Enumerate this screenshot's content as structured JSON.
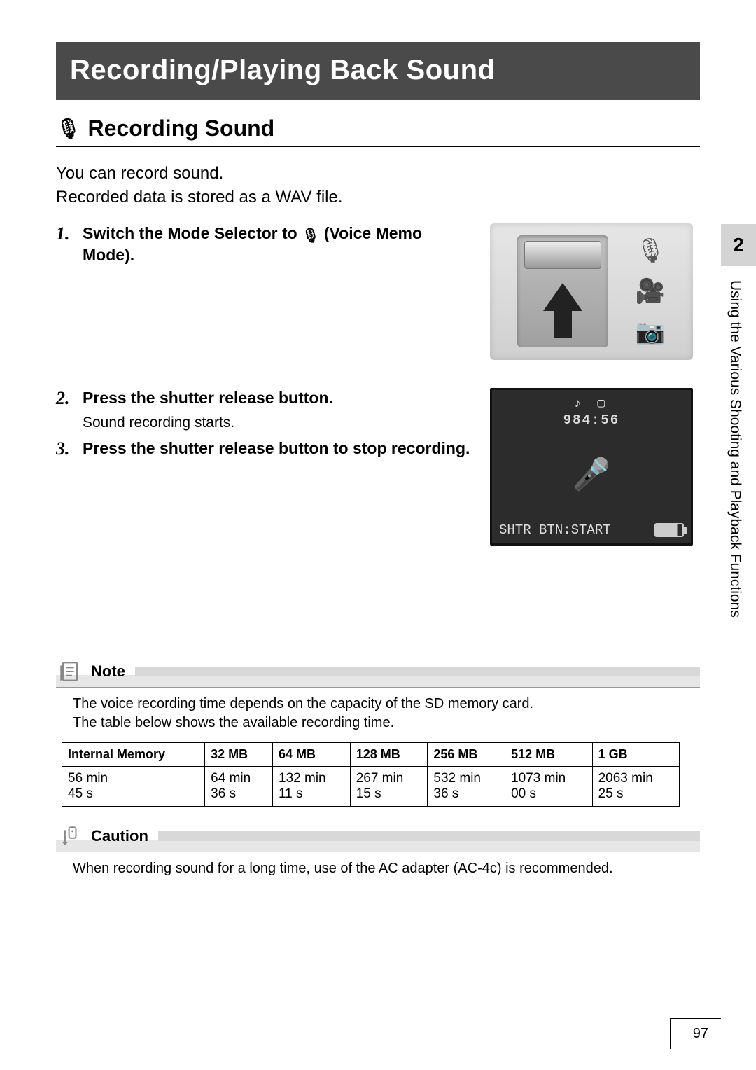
{
  "header": {
    "title": "Recording/Playing Back Sound"
  },
  "section": {
    "icon": "🎙",
    "title": "Recording Sound"
  },
  "intro": {
    "line1": "You can record sound.",
    "line2": "Recorded data is stored as a WAV file."
  },
  "steps": [
    {
      "num": "1.",
      "title_a": "Switch the Mode Selector to ",
      "title_b": " (Voice Memo Mode).",
      "mic": "🎙",
      "sub": ""
    },
    {
      "num": "2.",
      "title_a": "Press the shutter release button.",
      "title_b": "",
      "mic": "",
      "sub": "Sound recording starts."
    },
    {
      "num": "3.",
      "title_a": "Press the shutter release button to stop recording.",
      "title_b": "",
      "mic": "",
      "sub": ""
    }
  ],
  "lcd": {
    "top_icons": "♪  ▢",
    "time": "984:56",
    "mic": "🎤",
    "bottom_text": "SHTR BTN:START"
  },
  "mode_icons": {
    "mic": "🎙",
    "video": "🎥",
    "camera": "📷"
  },
  "chapter": {
    "number": "2",
    "label": "Using the Various Shooting and Playback Functions"
  },
  "note": {
    "title": "Note",
    "body1": "The voice recording time depends on the capacity of the SD memory card.",
    "body2": "The table below shows the available recording time."
  },
  "caution": {
    "title": "Caution",
    "body": "When recording sound for a long time, use of the AC adapter (AC-4c) is recommended."
  },
  "page_number": "97",
  "chart_data": {
    "type": "table",
    "headers": [
      "Internal Memory",
      "32 MB",
      "64 MB",
      "128 MB",
      "256 MB",
      "512 MB",
      "1 GB"
    ],
    "rows": [
      [
        {
          "min": "56 min",
          "sec": "45 s"
        },
        {
          "min": "64 min",
          "sec": "36 s"
        },
        {
          "min": "132 min",
          "sec": "11 s"
        },
        {
          "min": "267 min",
          "sec": "15 s"
        },
        {
          "min": "532 min",
          "sec": "36 s"
        },
        {
          "min": "1073 min",
          "sec": "00 s"
        },
        {
          "min": "2063 min",
          "sec": "25 s"
        }
      ]
    ]
  }
}
